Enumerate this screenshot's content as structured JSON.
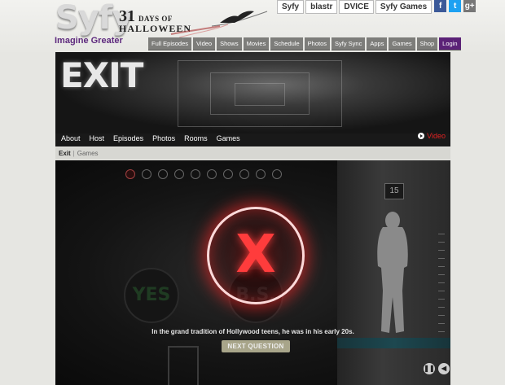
{
  "header": {
    "logo_text": "Syfy",
    "tagline": "Imagine Greater",
    "promo_big": "31",
    "promo_small": "DAYS OF",
    "promo_line2": "HALLOWEEN",
    "brands": [
      "Syfy",
      "blastr",
      "DVICE",
      "Syfy Games"
    ],
    "social": [
      {
        "name": "facebook",
        "glyph": "f",
        "color": "#3b5998"
      },
      {
        "name": "twitter",
        "glyph": "t",
        "color": "#1da1f2"
      },
      {
        "name": "google-plus",
        "glyph": "g+",
        "color": "#777777"
      }
    ],
    "nav": [
      "Full Episodes",
      "Video",
      "Shows",
      "Movies",
      "Schedule",
      "Photos",
      "Syfy Sync",
      "Apps",
      "Games",
      "Shop"
    ],
    "login": "Login"
  },
  "hero": {
    "title": "EXIT",
    "subnav": [
      "About",
      "Host",
      "Episodes",
      "Photos",
      "Rooms",
      "Games"
    ],
    "video_label": "Video",
    "video_color": "#e02020"
  },
  "breadcrumb": {
    "current": "Exit",
    "section": "Games"
  },
  "game": {
    "floor_number": "15",
    "progress_total": 10,
    "progress_active": 1,
    "yes_label": "YES",
    "bs_label": "B.S.",
    "result_label": "X",
    "answer_text": "In the grand tradition of Hollywood teens, he was in his early 20s.",
    "next_label": "NEXT QUESTION",
    "pause_icon": "pause-icon",
    "sound_icon": "sound-icon"
  }
}
